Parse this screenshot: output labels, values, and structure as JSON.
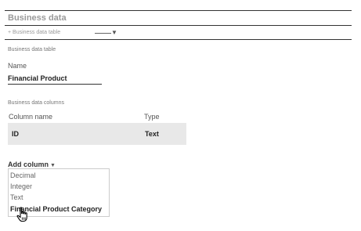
{
  "section": {
    "title": "Business data"
  },
  "add_table": {
    "label": "+ Business data table"
  },
  "table": {
    "heading": "Business data table",
    "name_label": "Name",
    "name_value": "Financial Product"
  },
  "columns": {
    "heading": "Business data columns",
    "header_name": "Column name",
    "header_type": "Type",
    "rows": [
      {
        "name": "ID",
        "type": "Text"
      }
    ]
  },
  "add_column": {
    "label": "Add column",
    "caret": "▼",
    "options": [
      "Decimal",
      "Integer",
      "Text",
      "Financial Product Category"
    ],
    "hovered_option": "Financial Product Category"
  },
  "icons": {
    "dropdown": "chevron-down-icon",
    "cursor": "hand-pointer-icon"
  }
}
